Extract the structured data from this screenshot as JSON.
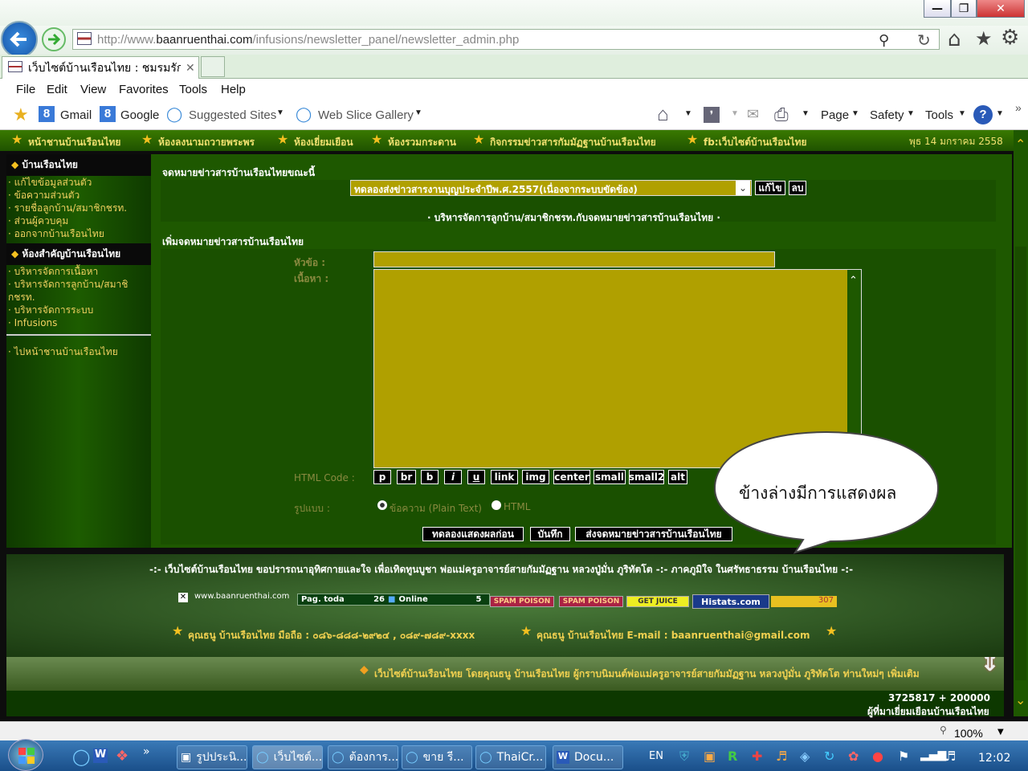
{
  "browser": {
    "url_prefix": "http://www.",
    "url_domain": "baanruenthai.com",
    "url_path": "/infusions/newsletter_panel/newsletter_admin.php",
    "tab_title": "เว็บไซต์บ้านเรือนไทย : ชมรมรัก...",
    "menu": [
      "File",
      "Edit",
      "View",
      "Favorites",
      "Tools",
      "Help"
    ],
    "favorites": [
      "Gmail",
      "Google",
      "Suggested Sites",
      "Web Slice Gallery"
    ],
    "commandbar": [
      "Page",
      "Safety",
      "Tools"
    ],
    "zoom": "100%"
  },
  "topnav": {
    "items": [
      "หน้าชานบ้านเรือนไทย",
      "ห้องลงนามถวายพระพร",
      "ห้องเยี่ยมเยือน",
      "ห้องรวมกระดาน",
      "กิจกรรมข่าวสารกัมมัฏฐานบ้านเรือนไทย",
      "fb:เว็บไซต์บ้านเรือนไทย"
    ],
    "date": "พุธ 14 มกราคม 2558"
  },
  "sidebar": {
    "section1_title": "บ้านเรือนไทย",
    "section1_items": [
      "แก้ไขข้อมูลส่วนตัว",
      "ข้อความส่วนตัว",
      "รายชื่อลูกบ้าน/สมาชิกชรท.",
      "ส่วนผู้ควบคุม",
      "ออกจากบ้านเรือนไทย"
    ],
    "section2_title": "ห้องสำคัญบ้านเรือนไทย",
    "section2_items": [
      "บริหารจัดการเนื้อหา",
      "บริหารจัดการลูกบ้าน/สมาชิกชรท.",
      "บริหารจัดการระบบ",
      "Infusions"
    ],
    "home_link": "ไปหน้าชานบ้านเรือนไทย"
  },
  "current": {
    "heading": "จดหมายข่าวสารบ้านเรือนไทยขณะนี้",
    "selected": "ทดลองส่งข่าวสารงานบุญประจำปีพ.ศ.2557(เนื่องจากระบบขัดข้อง)",
    "edit_label": "แก้ไข",
    "delete_label": "ลบ",
    "manage_link": "บริหารจัดการลูกบ้าน/สมาชิกชรท.กับจดหมายข่าวสารบ้านเรือนไทย"
  },
  "compose": {
    "heading": "เพิ่มจดหมายข่าวสารบ้านเรือนไทย",
    "subject_label": "หัวข้อ :",
    "body_label": "เนื้อหา :",
    "html_code_label": "HTML Code :",
    "html_buttons": [
      "p",
      "br",
      "b",
      "i",
      "u",
      "link",
      "img",
      "center",
      "small",
      "small2",
      "alt"
    ],
    "format_label": "รูปแบบ :",
    "format_plain": "ข้อความ (Plain Text)",
    "format_html": "HTML",
    "preview_label": "ทดลองแสดงผลก่อน",
    "save_label": "บันทึก",
    "send_label": "ส่งจดหมายข่าวสารบ้านเรือนไทย"
  },
  "callout": "ข้างล่างมีการแสดงผล",
  "footer": {
    "tribute": "-:- เว็บไซต์บ้านเรือนไทย ขอปรารถนาอุทิศกายและใจ เพื่อเทิดทูนบูชา พ่อแม่ครูอาจารย์สายกัมมัฏฐาน หลวงปู่มั่น ภูริทัตโต -:- ภาคภูมิใจ ในศรัทธาธรรม บ้านเรือนไทย -:-",
    "site_logo": "www.baanruenthai.com",
    "counter_label": "Pag. toda",
    "counter_value": "26",
    "online_label": "Online",
    "online_value": "5",
    "badges": [
      "SPAM POISON",
      "SPAM POISON",
      "GET JUICE",
      "Histats.com"
    ],
    "histats_count": "307",
    "contact": "คุณธนู บ้านเรือนไทย มือถือ : ๐๘๖-๘๘๘-๒๙๒๔ , ๐๘๙-๗๘๙-xxxx",
    "email": "คุณธนู บ้านเรือนไทย E-mail : baanruenthai@gmail.com",
    "marquee": "เว็บไซต์บ้านเรือนไทย โดยคุณธนู บ้านเรือนไทย ผู้กราบนิมนต์พ่อแม่ครูอาจารย์สายกัมมัฏฐาน หลวงปู่มั่น ภูริทัตโต ท่านใหม่ๆ เพิ่มเติม",
    "visit_count": "3725817 + 200000",
    "visit_label": "ผู้ที่มาเยี่ยมเยือนบ้านเรือนไทย"
  },
  "taskbar": {
    "items": [
      "รูปประนิ...",
      "เว็บไซต์...",
      "ต้องการ...",
      "ขาย รี...",
      "ThaiCr...",
      "Docu..."
    ],
    "lang": "EN",
    "time": "12:02"
  }
}
